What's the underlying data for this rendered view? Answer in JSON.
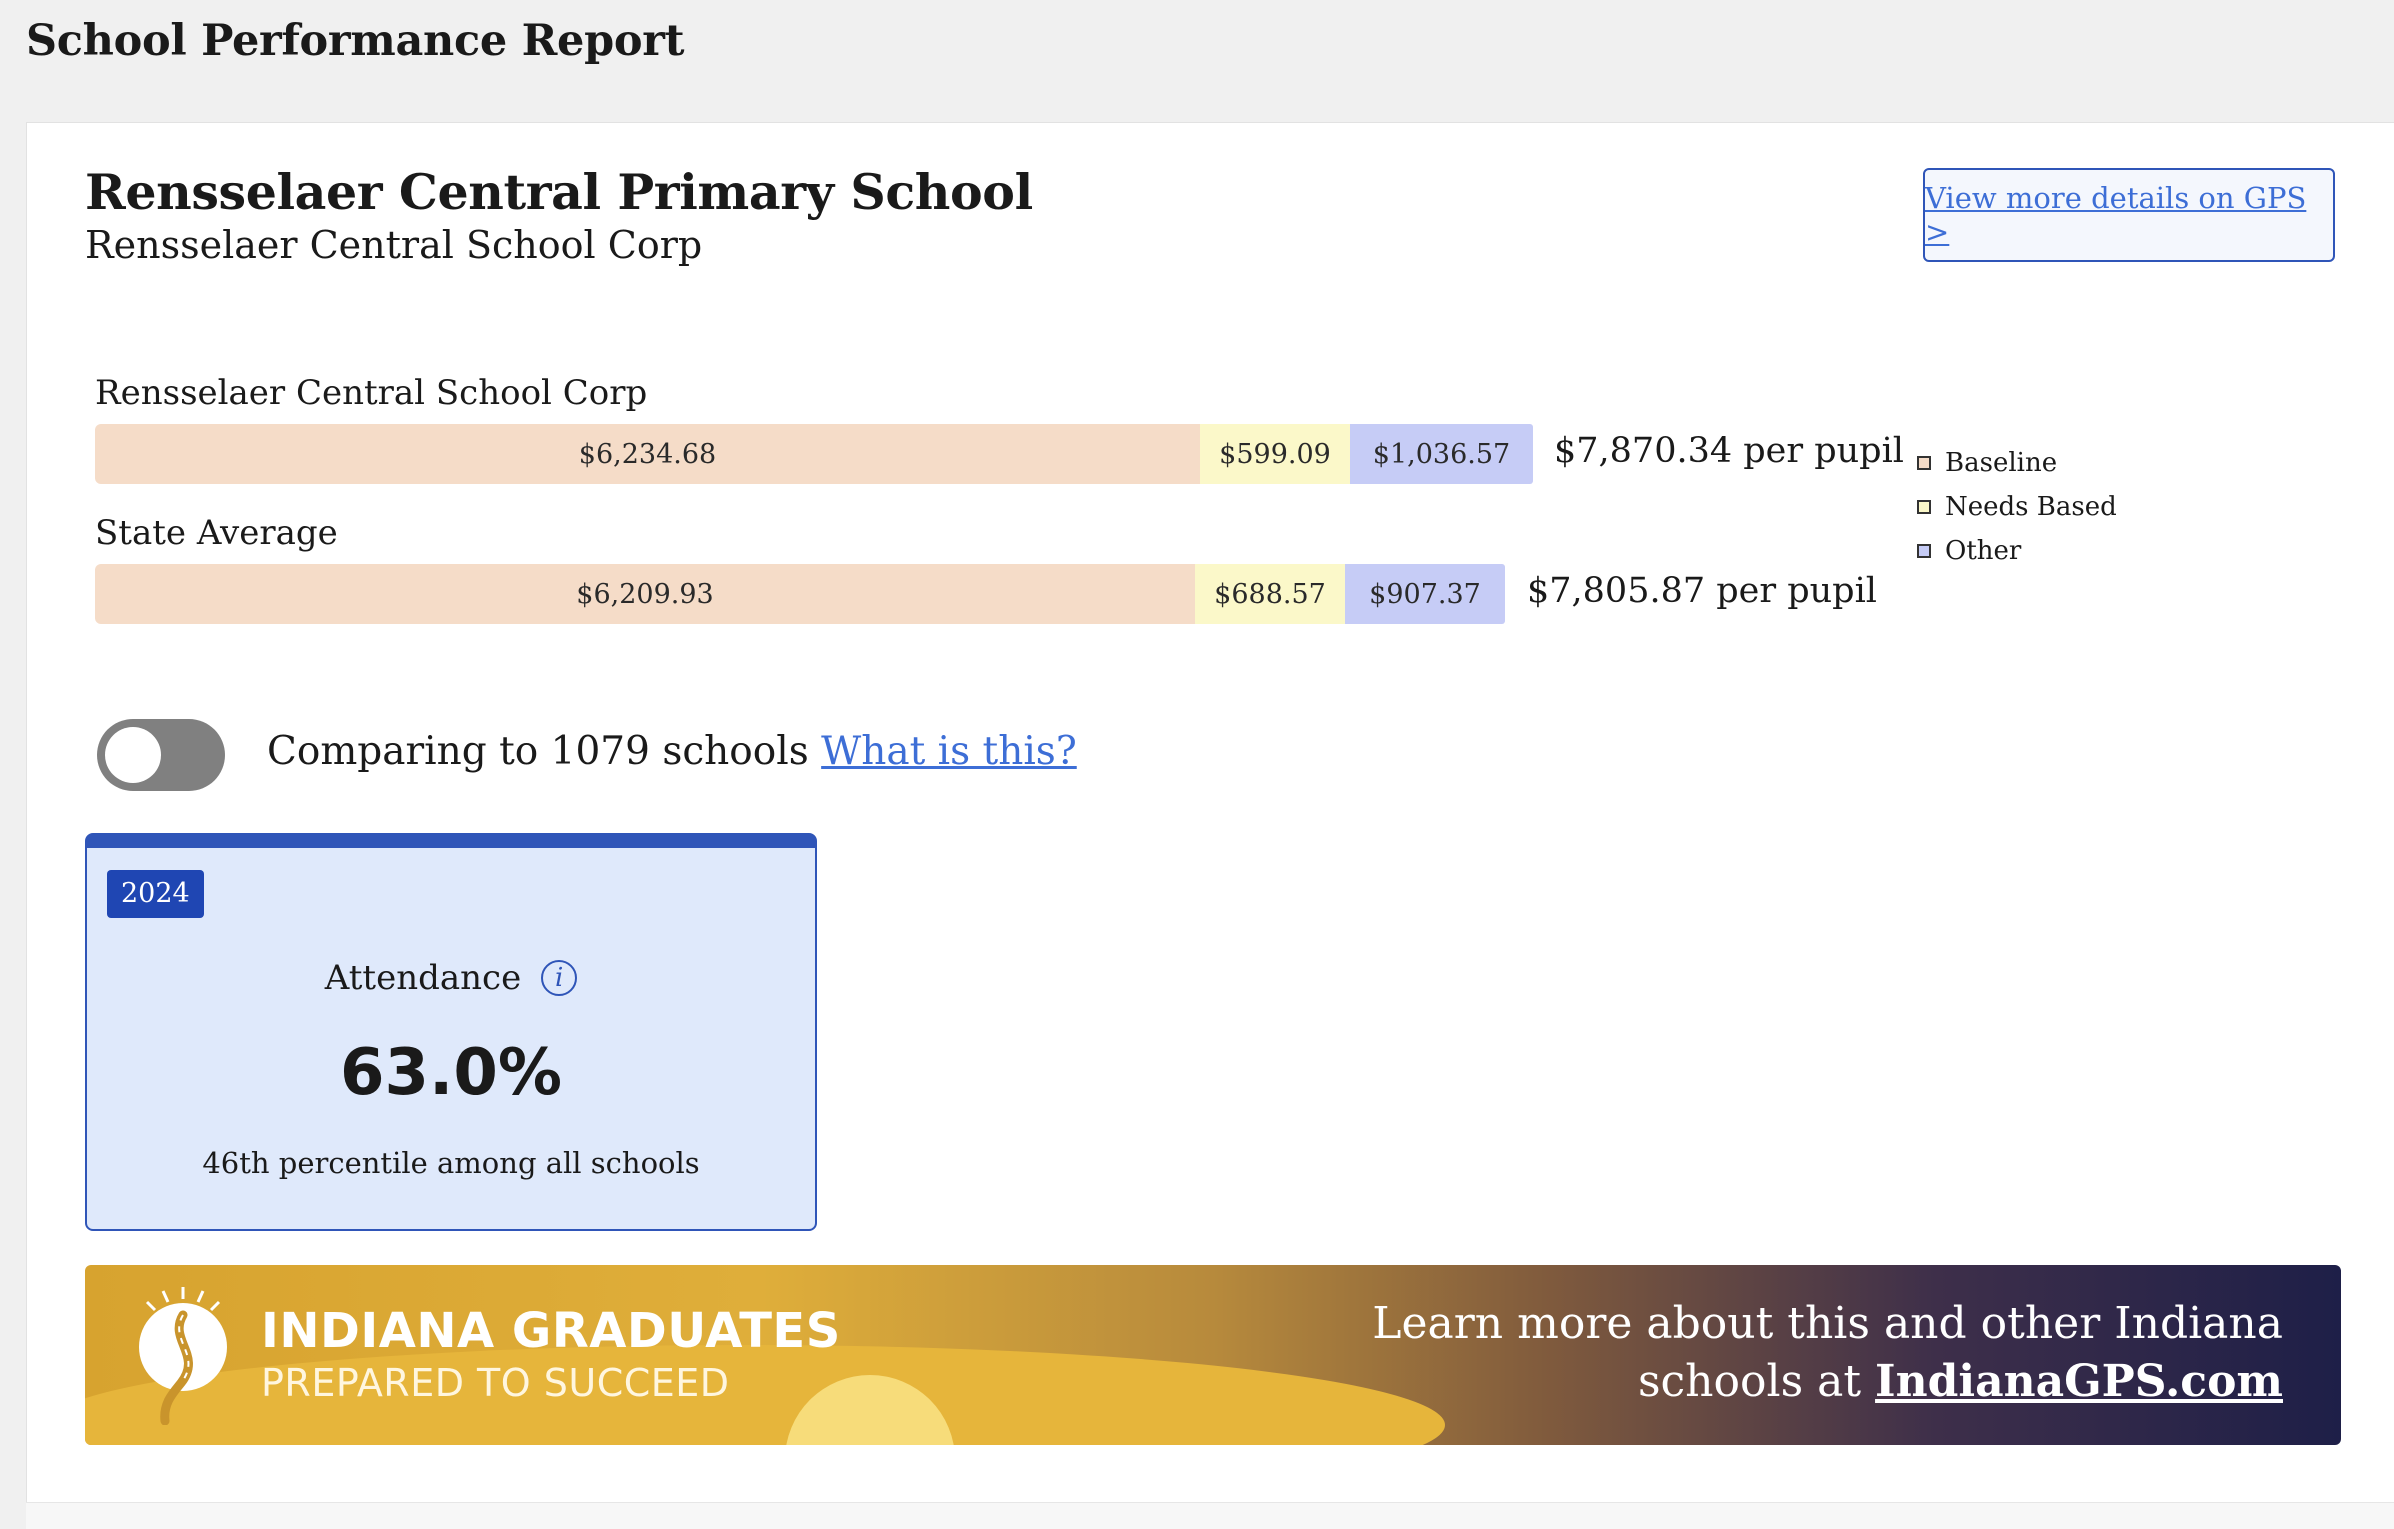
{
  "page": {
    "title": "School Performance Report"
  },
  "school": {
    "name": "Rensselaer Central Primary School",
    "corporation": "Rensselaer Central School Corp",
    "gps_button_label": "View more details on GPS >"
  },
  "funding": {
    "rows": [
      {
        "label": "Rensselaer Central School Corp",
        "baseline": "$6,234.68",
        "needs_based": "$599.09",
        "other": "$1,036.57",
        "total": "$7,870.34 per pupil"
      },
      {
        "label": "State Average",
        "baseline": "$6,209.93",
        "needs_based": "$688.57",
        "other": "$907.37",
        "total": "$7,805.87 per pupil"
      }
    ],
    "legend": [
      {
        "label": "Baseline",
        "color": "#f5dcc8"
      },
      {
        "label": "Needs Based",
        "color": "#fbf8c9"
      },
      {
        "label": "Other",
        "color": "#c6ccf6"
      }
    ]
  },
  "comparison": {
    "toggle_on": false,
    "text": "Comparing to 1079 schools",
    "link": "What is this?"
  },
  "attendance": {
    "year": "2024",
    "label": "Attendance",
    "value": "63.0%",
    "percentile_text": "46th percentile among all schools",
    "info_icon": "info-icon"
  },
  "banner": {
    "title": "INDIANA GRADUATES",
    "subtitle": "PREPARED TO SUCCEED",
    "text_line1": "Learn more about this and other Indiana",
    "text_line2_prefix": "schools at ",
    "link": "IndianaGPS.com"
  },
  "colors": {
    "accent": "#2f55b8",
    "link": "#3d6ed6"
  }
}
